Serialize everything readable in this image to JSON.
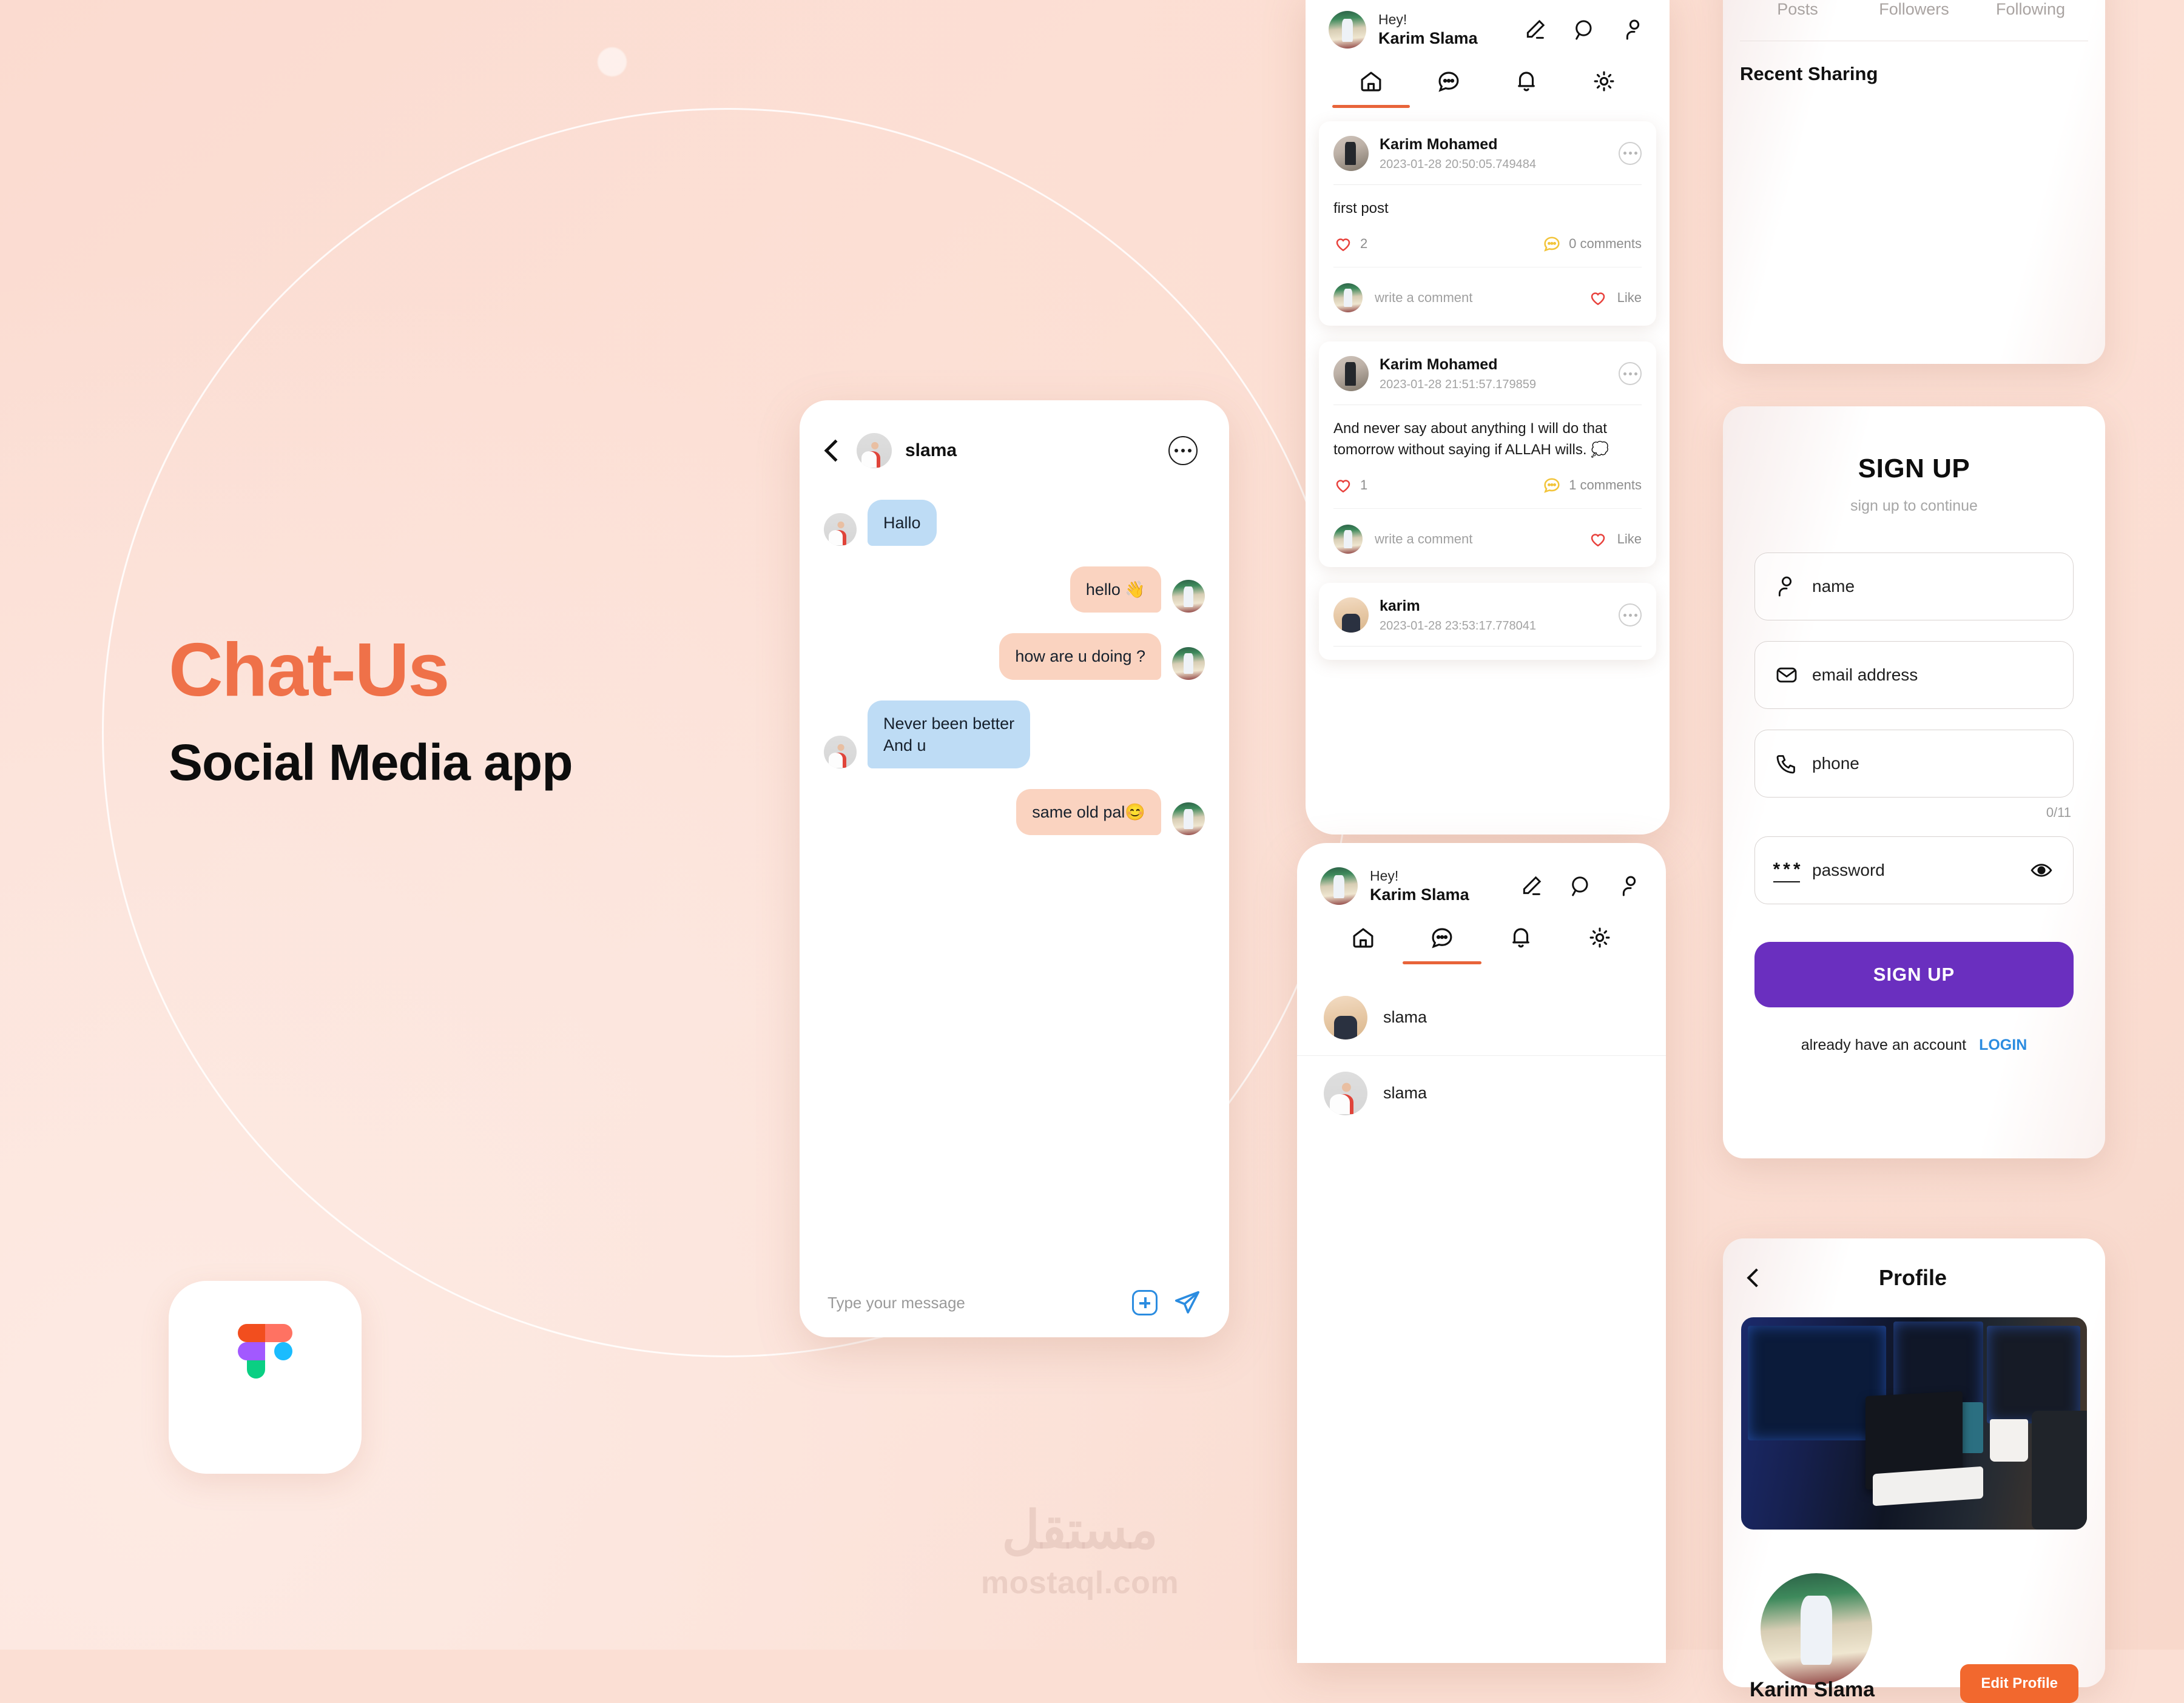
{
  "brand": {
    "title": "Chat-Us",
    "subtitle": "Social Media app",
    "title_color": "#ef7149",
    "accent_orange": "#e8643a",
    "accent_purple": "#6a2fbf",
    "accent_blue": "#2b8ce0"
  },
  "watermark": {
    "arabic": "مستقل",
    "latin": "mostaql.com"
  },
  "chat_screen": {
    "contact_name": "slama",
    "messages": [
      {
        "text": "Hallo",
        "side": "in"
      },
      {
        "text": "hello 👋",
        "side": "out"
      },
      {
        "text": "how are u doing ?",
        "side": "out"
      },
      {
        "text": "Never been better\nAnd u",
        "side": "in"
      },
      {
        "text": "same old pal😊",
        "side": "out"
      }
    ],
    "input_placeholder": "Type your message"
  },
  "feed_screen": {
    "greeting": "Hey!",
    "user_name": "Karim Slama",
    "header_icons": [
      "edit-icon",
      "search-icon",
      "user-icon"
    ],
    "tabs": [
      {
        "icon": "home-icon",
        "active": true
      },
      {
        "icon": "chat-icon",
        "active": false
      },
      {
        "icon": "bell-icon",
        "active": false
      },
      {
        "icon": "settings-icon",
        "active": false
      }
    ],
    "posts": [
      {
        "author": "Karim Mohamed",
        "time": "2023-01-28 20:50:05.749484",
        "text": "first post",
        "likes": "2",
        "comments": "0 comments",
        "comment_placeholder": "write a comment",
        "like_label": "Like"
      },
      {
        "author": "Karim Mohamed",
        "time": "2023-01-28 21:51:57.179859",
        "text": "And never say about anything I will do that tomorrow without saying if ALLAH wills. 💭",
        "likes": "1",
        "comments": "1 comments",
        "comment_placeholder": "write a comment",
        "like_label": "Like"
      },
      {
        "author": "karim",
        "time": "2023-01-28 23:53:17.778041",
        "text": "",
        "likes": "",
        "comments": "",
        "comment_placeholder": "",
        "like_label": ""
      }
    ]
  },
  "chat_list_screen": {
    "greeting": "Hey!",
    "user_name": "Karim Slama",
    "items": [
      {
        "name": "slama"
      },
      {
        "name": "slama"
      }
    ]
  },
  "recent_sharing": {
    "tabs": [
      "Posts",
      "Followers",
      "Following"
    ],
    "title": "Recent Sharing"
  },
  "signup": {
    "title": "SIGN UP",
    "subtitle": "sign up to continue",
    "fields": [
      {
        "placeholder": "name",
        "icon": "user-icon"
      },
      {
        "placeholder": "email address",
        "icon": "mail-icon"
      },
      {
        "placeholder": "phone",
        "icon": "phone-icon"
      },
      {
        "placeholder": "password",
        "icon": "password-icon"
      }
    ],
    "phone_counter": "0/11",
    "button_label": "SIGN UP",
    "footer_text": "already have an account",
    "login_label": "LOGIN"
  },
  "profile": {
    "title": "Profile",
    "name": "Karim Slama",
    "edit_label": "Edit Profile"
  }
}
